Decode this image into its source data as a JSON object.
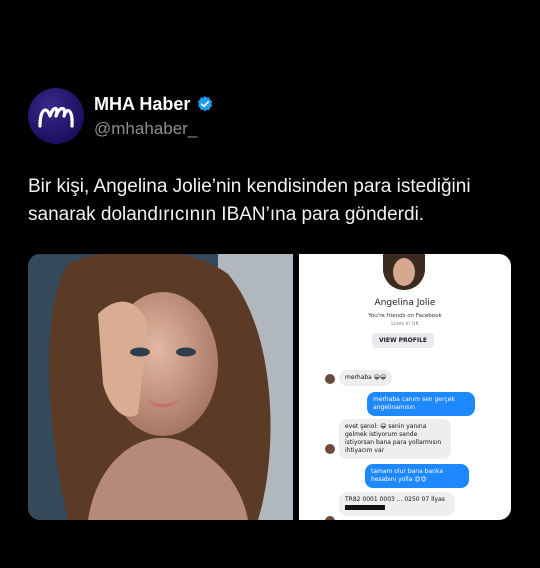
{
  "account": {
    "display_name": "MHA Haber",
    "handle": "@mhahaber_",
    "verified_icon": "verified-badge-icon",
    "accent_color": "#1d9bf0"
  },
  "tweet": {
    "text": "Bir kişi, Angelina Jolie’nin kendisinden para istediğini sanarak dolandırıcının IBAN’ına para gönderdi."
  },
  "chat": {
    "name": "Angelina Jolie",
    "friends_line": "You're friends on Facebook",
    "location_line": "Lives in UK",
    "view_profile_label": "VIEW PROFILE",
    "messages": [
      {
        "side": "in",
        "text": "merhaba 😀😀"
      },
      {
        "side": "out",
        "text": "merhaba canım sen gerçek angelinamısın"
      },
      {
        "side": "in",
        "text": "evet şenol: 😀 senin yanına gelmek istiyorum sende istiyorsan bana para yollarmısın ihtiyacım var"
      },
      {
        "side": "out",
        "text": "tamam olur bana banka hesabını yolla 😍😍"
      },
      {
        "side": "in",
        "text": "TR82 0001 0003 ... 0250 07 İlyas"
      }
    ]
  }
}
